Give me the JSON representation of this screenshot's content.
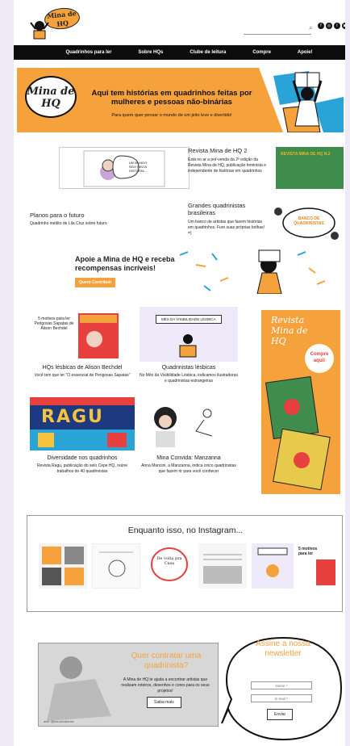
{
  "header": {
    "logo_text": "Mina de HQ",
    "social_icons": [
      "facebook-icon",
      "instagram-icon",
      "twitter-icon",
      "youtube-icon"
    ]
  },
  "nav": {
    "items": [
      "Quadrinhos para ler",
      "Sobre HQs",
      "Clube de leitura",
      "Compre",
      "Apoie!"
    ]
  },
  "hero": {
    "bubble_text": "Mina de HQ",
    "title": "Aqui tem histórias em quadrinhos feitas por mulheres e pessoas não-binárias",
    "subtitle": "Para quem quer pensar o mundo de um jeito leve e divertido!"
  },
  "featured": {
    "comic_bubble": "UM MUNDO SEM TANTA HISTÓRIA...",
    "left_title": "Planos para o futuro",
    "left_text": "Quadrinho inédito de Lila Cruz sobre futuro",
    "revista_title": "Revista Mina de HQ 2",
    "revista_text": "Está no ar a pré-venda da 2ª edição da Revista Mina de HQ, publicação feminista e independente de histórias em quadrinhos",
    "revista_image_text": "REVISTA MINA DE HQ N.2",
    "grandes_title": "Grandes quadrinistas brasileiras",
    "grandes_text": "Um banco de artistas que fazem histórias em quadrinhos. Fure suas próprias bolhas! =)",
    "banco_bubble": "BANCO DE QUADRINISTAS"
  },
  "support": {
    "title": "Apoie a Mina de HQ e receba recompensas incríveis!",
    "button": "Quero Contribuir"
  },
  "cards": [
    {
      "image_text": "5 motivos para ler Perigosas Sapatas de Alison Bechdel",
      "title": "HQs lésbicas de Alison Bechdel",
      "text": "Você tem que ler \"O essencial de Perigosas Sapatas\""
    },
    {
      "image_text": "MÊS DA VISIBILIDADE LÉSBICA",
      "title": "Quadrinistas lésbicas",
      "text": "No Mês da Visibilidade Lésbica, indicamos ilustradoras e quadrinistas estrangeiras"
    },
    {
      "image_text": "RAGU",
      "title": "Diversidade nos quadrinhos",
      "text": "Revista Ragu, publicação do selo Cepe HQ, reúne trabalhos de 40 quadrinistas"
    },
    {
      "image_text": "",
      "title": "Mina Convida: Manzanna",
      "text": "Anna Mancini, a Manzanna, indica cinco quadrinistas que fazem rir para você conhecer"
    }
  ],
  "revista_sidebar": {
    "title": "Revista Mina de HQ",
    "badge": "Compre aqui!"
  },
  "instagram": {
    "title": "Enquanto isso, no Instagram...",
    "posts": [
      "",
      "",
      "De volta pra Casa",
      "",
      "",
      "5 motivos para ler"
    ]
  },
  "contract": {
    "title": "Quer contratar uma quadrinista?",
    "text": "A Mina de HQ te ajuda a encontrar artistas que realizam roteiros, desenhos e cores para os seus projetos!",
    "button": "Saiba mais",
    "credit": "arte: @veronicaberta"
  },
  "newsletter": {
    "title": "Assine a nossa newsletter",
    "name_placeholder": "Nome *",
    "email_placeholder": "E-mail *",
    "submit": "Enviar"
  },
  "colors": {
    "accent_orange": "#f6a23c",
    "nav_black": "#0c0c0c",
    "lavender_bg": "#eeeaf7",
    "green": "#3f8c4d"
  }
}
